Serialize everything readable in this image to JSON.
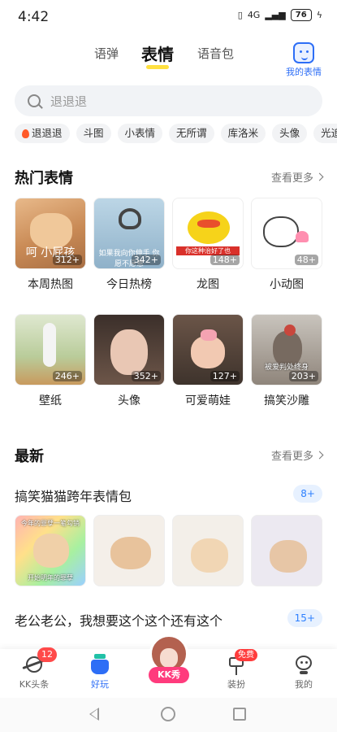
{
  "status": {
    "time": "4:42",
    "signal": "4G",
    "battery": "76"
  },
  "top_tabs": [
    "语弹",
    "表情",
    "语音包"
  ],
  "my_emoji": {
    "label": "我的表情"
  },
  "search": {
    "placeholder": "退退退"
  },
  "chips": [
    "退退退",
    "斗图",
    "小表情",
    "无所谓",
    "库洛米",
    "头像",
    "光追"
  ],
  "hot": {
    "title": "热门表情",
    "more": "查看更多",
    "items": [
      {
        "label": "本周热图",
        "count": "312+",
        "caption": "呵 小屁孩"
      },
      {
        "label": "今日热榜",
        "count": "342+",
        "caption": "如果我向你伸手 你愿不愿意"
      },
      {
        "label": "龙图",
        "count": "148+",
        "caption": "你这种治好了也"
      },
      {
        "label": "小动图",
        "count": "48+",
        "caption": ""
      },
      {
        "label": "壁纸",
        "count": "246+",
        "caption": ""
      },
      {
        "label": "头像",
        "count": "352+",
        "caption": ""
      },
      {
        "label": "可爱萌娃",
        "count": "127+",
        "caption": ""
      },
      {
        "label": "搞笑沙雕",
        "count": "203+",
        "caption": "被爱判处终身"
      }
    ]
  },
  "latest": {
    "title": "最新",
    "more": "查看更多",
    "packs": [
      {
        "title": "搞笑猫猫跨年表情包",
        "count": "8+",
        "captions": [
          "今年的罪孽一笔勾销",
          "开始明年的罪孽",
          "",
          "",
          ""
        ]
      },
      {
        "title": "老公老公，我想要这个这个还有这个",
        "count": "15+"
      }
    ]
  },
  "bottom_nav": {
    "items": [
      "KK头条",
      "好玩",
      "KK秀",
      "装扮",
      "我的"
    ],
    "badge": "12",
    "free": "免费"
  },
  "colors": {
    "accent": "#2d6ef6",
    "badge": "#ff4a4a",
    "kk_pink": "#ff3b7d"
  }
}
